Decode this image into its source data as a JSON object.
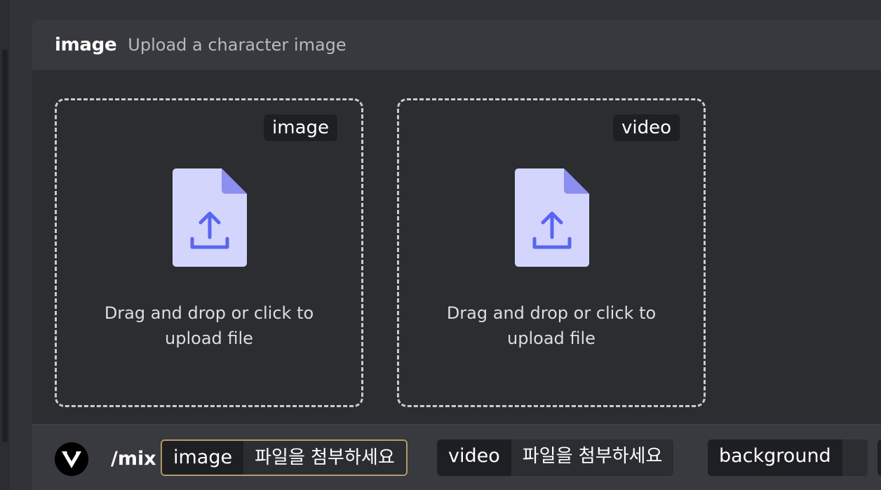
{
  "header": {
    "option_name": "image",
    "option_description": "Upload a character image"
  },
  "dropzones": [
    {
      "tag": "image",
      "line1": "Drag and drop or click to",
      "line2": "upload file"
    },
    {
      "tag": "video",
      "line1": "Drag and drop or click to",
      "line2": "upload file"
    }
  ],
  "command": {
    "name": "/mix",
    "options": [
      {
        "label": "image",
        "value": "파일을 첨부하세요",
        "active": true
      },
      {
        "label": "video",
        "value": "파일을 첨부하세요",
        "active": false
      },
      {
        "label": "background",
        "value": "",
        "active": false
      }
    ]
  },
  "icons": {
    "file_upload": "file-upload-icon",
    "bot_avatar": "viggle-logo-icon"
  },
  "colors": {
    "accent": "#5865f2",
    "file_bg": "#d4d5fc",
    "file_fold": "#8b8ff0",
    "active_outline": "#b49a6a"
  }
}
